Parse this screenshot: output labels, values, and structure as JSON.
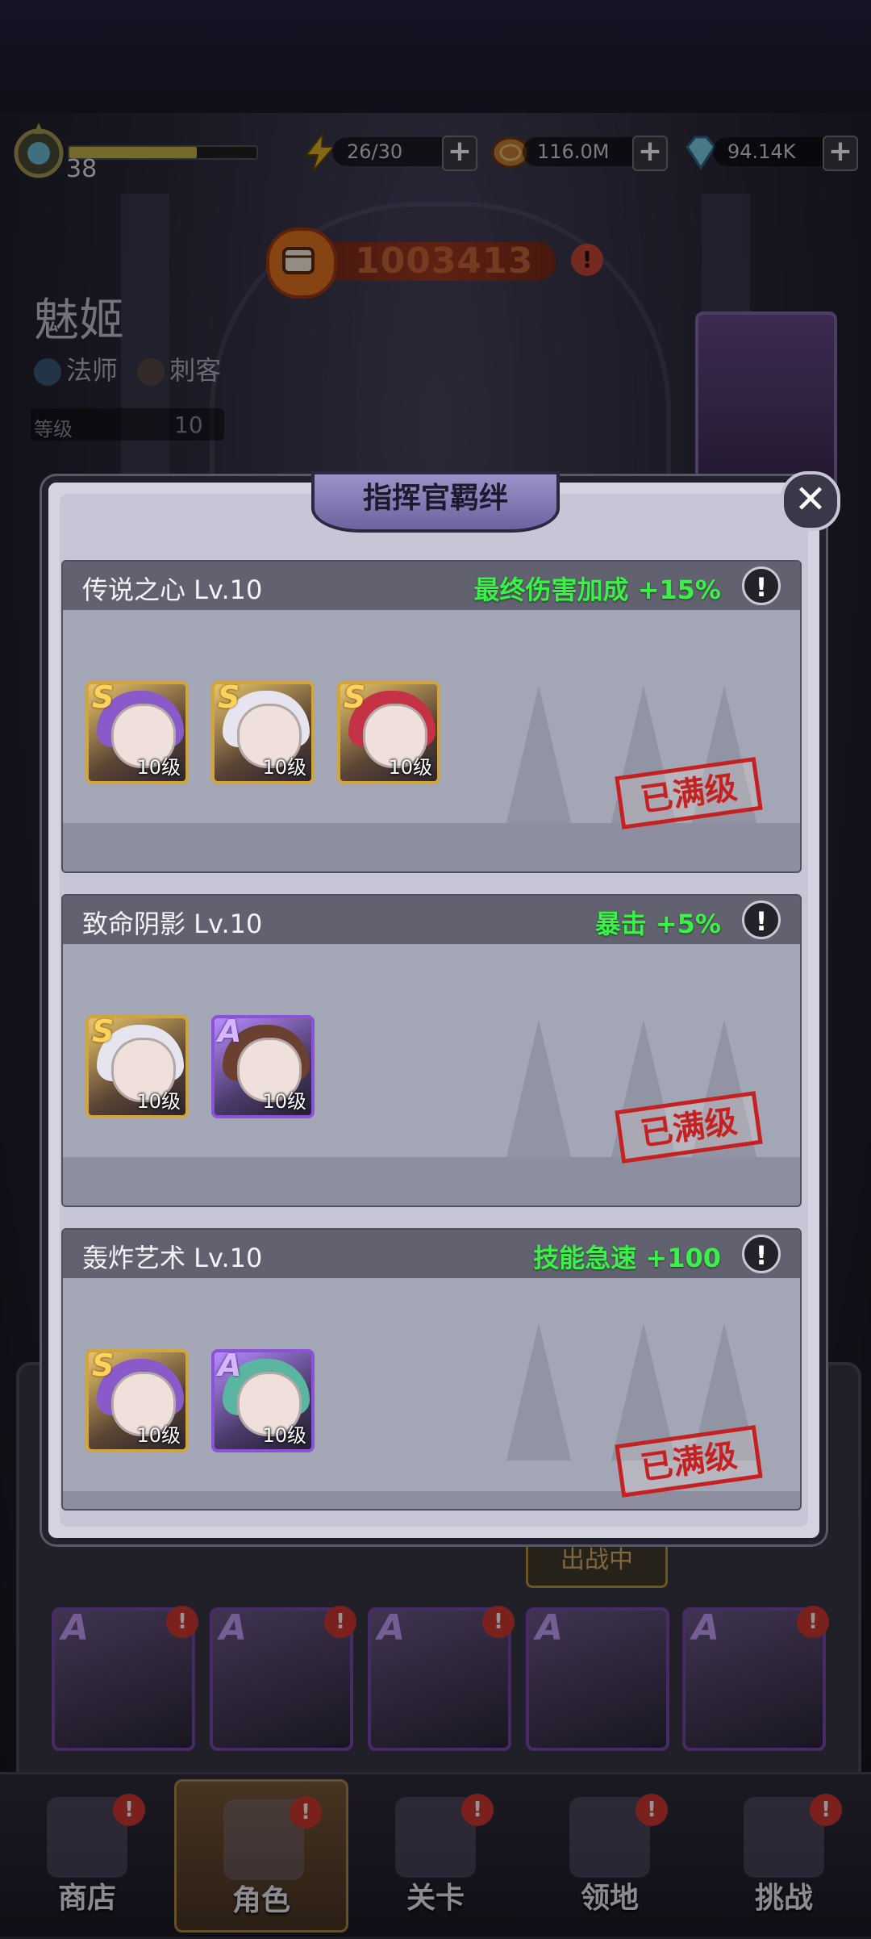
{
  "hud": {
    "level": "38",
    "xp_fraction": 0.68,
    "energy": "26/30",
    "gold": "116.0M",
    "diamonds": "94.14K",
    "plus": "+"
  },
  "power": {
    "value": "1003413",
    "warn": "!"
  },
  "hero": {
    "name": "魅姬",
    "class1": "法师",
    "class2": "刺客",
    "level_label": "等级",
    "level_value": "10"
  },
  "modal": {
    "title": "指挥官羁绊",
    "close": "✕",
    "bonds": [
      {
        "name": "传说之心 Lv.10",
        "effect": "最终伤害加成 +15%",
        "stamp": "已满级",
        "heroes": [
          {
            "rank": "S",
            "level": "10级",
            "hair": "#8a5acb"
          },
          {
            "rank": "S",
            "level": "10级",
            "hair": "#e6e4ee"
          },
          {
            "rank": "S",
            "level": "10级",
            "hair": "#c53246"
          }
        ]
      },
      {
        "name": "致命阴影 Lv.10",
        "effect": "暴击 +5%",
        "stamp": "已满级",
        "heroes": [
          {
            "rank": "S",
            "level": "10级",
            "hair": "#e6e4ee"
          },
          {
            "rank": "A",
            "level": "10级",
            "hair": "#6a4030"
          }
        ]
      },
      {
        "name": "轰炸艺术 Lv.10",
        "effect": "技能急速 +100",
        "stamp": "已满级",
        "heroes": [
          {
            "rank": "S",
            "level": "10级",
            "hair": "#8a5acb"
          },
          {
            "rank": "A",
            "level": "10级",
            "hair": "#5ab6a0"
          }
        ]
      }
    ]
  },
  "grid": {
    "on_battle": "出战中",
    "rank_a": "A",
    "alert": "!"
  },
  "nav": {
    "items": [
      "商店",
      "角色",
      "关卡",
      "领地",
      "挑战"
    ],
    "alert": "!"
  },
  "colors": {
    "effect_green": "#3cf04a",
    "stamp_red": "#c42222",
    "rank_s_gold": "#d2a53c",
    "rank_a_purple": "#8a52d8"
  }
}
